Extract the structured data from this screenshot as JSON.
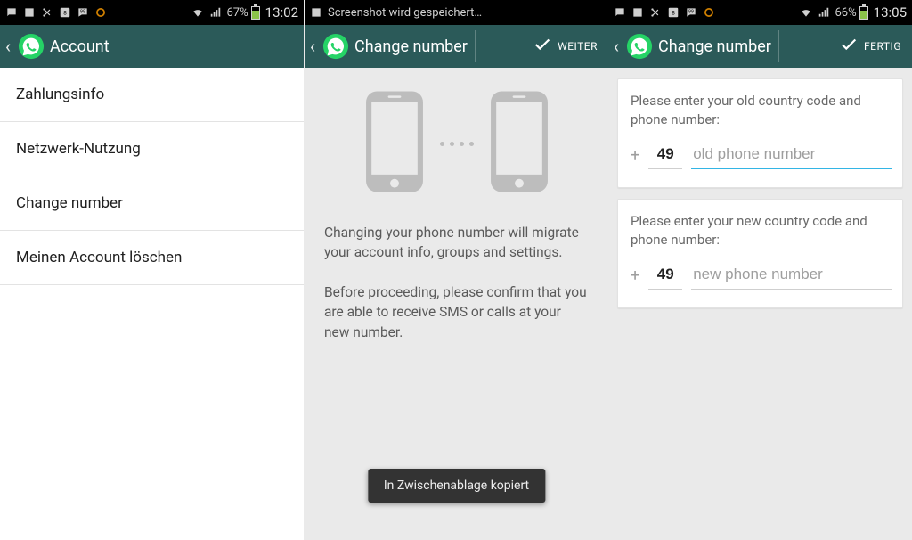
{
  "statusbar": {
    "left": {
      "battery_pct": "67%",
      "clock": "13:02"
    },
    "mid": {
      "text": "Screenshot wird gespeichert…"
    },
    "right": {
      "battery_pct": "66%",
      "clock": "13:05"
    }
  },
  "left": {
    "title": "Account",
    "items": [
      {
        "label": "Zahlungsinfo"
      },
      {
        "label": "Netzwerk-Nutzung"
      },
      {
        "label": "Change number"
      },
      {
        "label": "Meinen Account löschen"
      }
    ]
  },
  "mid": {
    "title": "Change number",
    "action_label": "WEITER",
    "para1": "Changing your phone number will migrate your account info, groups and settings.",
    "para2": "Before proceeding, please confirm that you are able to receive SMS or calls at your new number.",
    "toast": "In Zwischenablage kopiert"
  },
  "right": {
    "title": "Change number",
    "action_label": "FERTIG",
    "old_prompt": "Please enter your old country code and phone number:",
    "new_prompt": "Please enter your new country code and phone number:",
    "plus": "+",
    "old_cc": "49",
    "old_placeholder": "old phone number",
    "new_cc": "49",
    "new_placeholder": "new phone number"
  }
}
